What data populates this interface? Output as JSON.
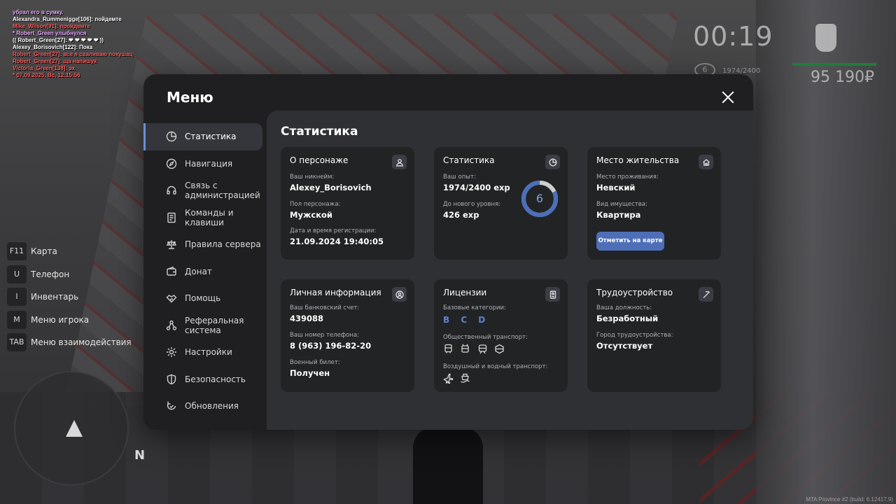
{
  "chat": [
    {
      "text": "убрал его в сумку.",
      "color": "#e9a6ff"
    },
    {
      "text": "Alexandra_Rummenigge[106]: пойдемте",
      "color": "#ffffff"
    },
    {
      "text": "Mike_Wilson[91]: пройдемте",
      "color": "#ff5a5a"
    },
    {
      "text": "* Robert_Green улыбнулся",
      "color": "#e9a6ff"
    },
    {
      "text": "(( Robert_Green[27]: ❤ ❤ ❤ ❤ ❤ ))",
      "color": "#ffffff"
    },
    {
      "text": "Alexey_Borisovich[122]: Пока",
      "color": "#ffffff"
    },
    {
      "text": "Robert_Green[27]: все я сваливаю покушац",
      "color": "#ff5a5a"
    },
    {
      "text": "Robert_Green[27]: ща напишук",
      "color": "#ff5a5a"
    },
    {
      "text": "Victoria_Green[138]: эх",
      "color": "#ff5a5a"
    },
    {
      "text": "* 07.09.2025, Вс, 12:15:56",
      "color": "#ff5a5a"
    }
  ],
  "hud": {
    "time": "00:19",
    "level": "6",
    "exp": "1974/2400",
    "money": "95 190₽"
  },
  "hotkeys": [
    {
      "key": "F11",
      "label": "Карта"
    },
    {
      "key": "U",
      "label": "Телефон"
    },
    {
      "key": "I",
      "label": "Инвентарь"
    },
    {
      "key": "M",
      "label": "Меню игрока"
    },
    {
      "key": "TAB",
      "label": "Меню взаимодействия"
    }
  ],
  "minimap": {
    "north": "N"
  },
  "build": "MTA Province #2 (build: 6.12417.9)",
  "menu": {
    "title": "Меню",
    "nav": [
      {
        "label": "Статистика",
        "icon": "pie-chart-icon",
        "active": true
      },
      {
        "label": "Навигация",
        "icon": "compass-icon"
      },
      {
        "label": "Связь с администрацией",
        "icon": "headset-icon"
      },
      {
        "label": "Команды и клавиши",
        "icon": "document-icon"
      },
      {
        "label": "Правила сервера",
        "icon": "scales-icon"
      },
      {
        "label": "Донат",
        "icon": "wallet-icon"
      },
      {
        "label": "Помощь",
        "icon": "handshake-icon"
      },
      {
        "label": "Реферальная система",
        "icon": "network-icon"
      },
      {
        "label": "Настройки",
        "icon": "gear-icon"
      },
      {
        "label": "Безопасность",
        "icon": "shield-icon"
      },
      {
        "label": "Обновления",
        "icon": "refresh-icon"
      }
    ],
    "heading": "Статистика",
    "cards": {
      "persona": {
        "title": "О персонаже",
        "nick_label": "Ваш никнейм:",
        "nick": "Alexey_Borisovich",
        "gender_label": "Пол персонажа:",
        "gender": "Мужской",
        "reg_label": "Дата и время регистрации:",
        "reg": "21.09.2024 19:40:05"
      },
      "stats": {
        "title": "Статистика",
        "exp_label": "Ваш опыт:",
        "exp": "1974/2400 exp",
        "next_label": "До нового уровня:",
        "next": "426 exp",
        "level": "6",
        "progress": 0.8225
      },
      "home": {
        "title": "Место жительства",
        "place_label": "Место проживания:",
        "place": "Невский",
        "prop_label": "Вид имущества:",
        "prop": "Квартира",
        "button": "Отметить на карте"
      },
      "personal": {
        "title": "Личная информация",
        "bank_label": "Ваш банковский счет:",
        "bank": "439088",
        "phone_label": "Ваш номер телефона:",
        "phone": "8 (963) 196-82-20",
        "military_label": "Военный билет:",
        "military": "Получен"
      },
      "licenses": {
        "title": "Лицензии",
        "base_label": "Базовые категории:",
        "base": "B C D",
        "public_label": "Общественный транспорт:",
        "air_label": "Воздушный и водный транспорт:"
      },
      "job": {
        "title": "Трудоустройство",
        "pos_label": "Ваша должность:",
        "pos": "Безработный",
        "city_label": "Город трудоустройства:",
        "city": "Отсутствует"
      }
    }
  }
}
